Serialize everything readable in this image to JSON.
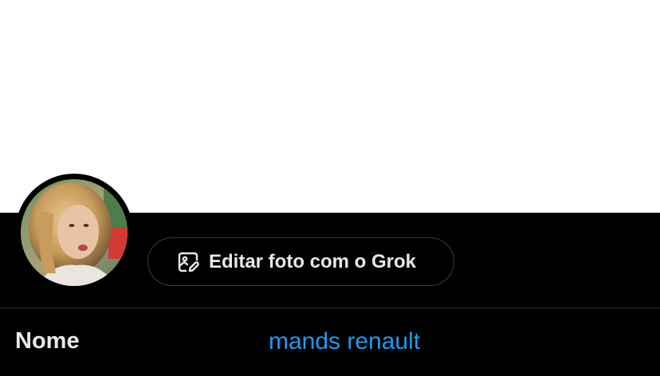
{
  "header": {
    "banner_color": "#ffffff"
  },
  "profile": {
    "avatar_icon": "profile-photo",
    "edit_with_grok_icon": "image-edit-icon",
    "edit_with_grok_label": "Editar foto com o Grok"
  },
  "fields": {
    "name_label": "Nome",
    "name_value": "mands renault"
  },
  "colors": {
    "background": "#000000",
    "accent": "#1d9bf0",
    "text_primary": "#e7e9ea",
    "border": "#3a3d41"
  }
}
